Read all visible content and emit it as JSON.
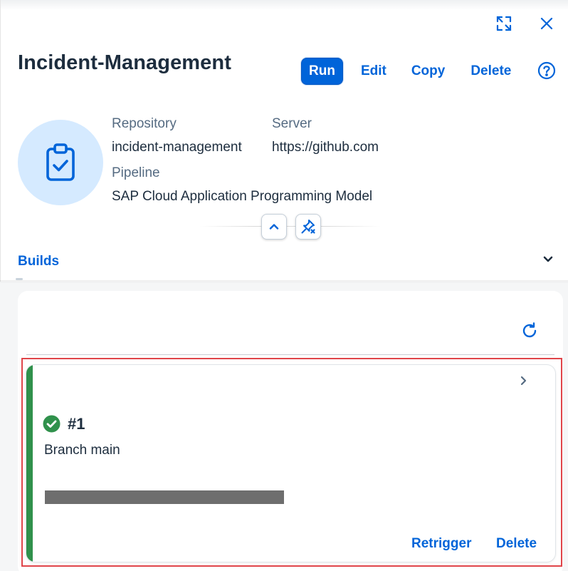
{
  "header": {
    "title": "Incident-Management",
    "actions": {
      "run_label": "Run",
      "edit_label": "Edit",
      "copy_label": "Copy",
      "delete_label": "Delete"
    },
    "window_icons": [
      "exit-fullscreen-icon",
      "close-icon",
      "help-icon"
    ]
  },
  "details": {
    "avatar_icon": "clipboard-check-icon",
    "repository_label": "Repository",
    "repository_value": "incident-management",
    "server_label": "Server",
    "server_value": "https://github.com",
    "pipeline_label": "Pipeline",
    "pipeline_value": "SAP Cloud Application Programming Model"
  },
  "tabs": {
    "builds_label": "Builds"
  },
  "builds": [
    {
      "number": "#1",
      "status": "success",
      "branch": "Branch main",
      "retrigger_label": "Retrigger",
      "delete_label": "Delete"
    }
  ],
  "colors": {
    "accent": "#0064d9",
    "success": "#30914c",
    "avatar_bg": "#d5eaff",
    "highlight": "#e0454a"
  }
}
